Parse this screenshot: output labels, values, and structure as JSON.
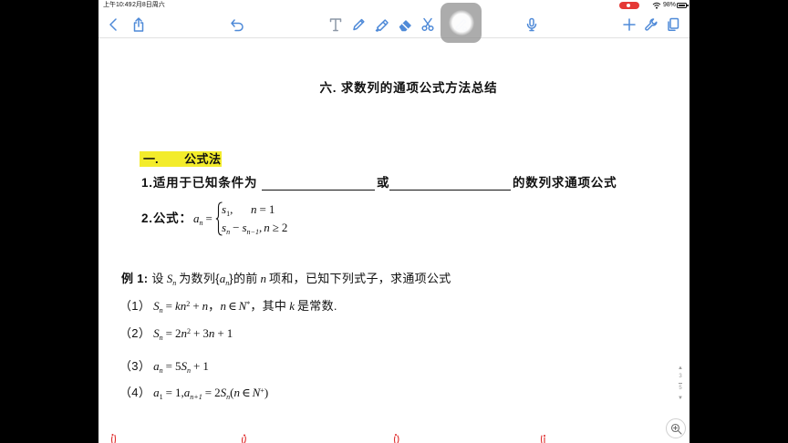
{
  "status_bar": {
    "time": "上午10:49",
    "date": "2月8日周六",
    "battery": "98%",
    "icons": [
      "screen-recording-icon",
      "wifi-icon",
      "battery-icon"
    ]
  },
  "toolbar": {
    "left_icons": [
      "chevron-left-icon",
      "share-icon",
      "undo-icon"
    ],
    "tools": [
      "text-tool-icon",
      "pen-icon",
      "highlighter-icon",
      "eraser-icon",
      "scissors-icon",
      "laser-pointer-icon",
      "microphone-icon"
    ],
    "right_icons": [
      "plus-icon",
      "wrench-icon",
      "pages-icon"
    ],
    "active_tool": "laser-pointer-icon"
  },
  "colors": {
    "accent": "#4f8ad8",
    "highlight": "#f3ec2b",
    "recording": "#e53935",
    "ink": "#e02d2d",
    "text": "#111111"
  },
  "document": {
    "title": "六. 求数列的通项公式方法总结",
    "section": {
      "number": "一.",
      "name": "公式法"
    },
    "item1": {
      "text_a": "1.适用于已知条件为",
      "text_b": "或",
      "text_c": "的数列求通项公式"
    },
    "item2": {
      "label": "2.公式：",
      "lhs": [
        "a",
        "n",
        "="
      ],
      "case1": [
        "s",
        "1",
        ",",
        "n",
        "=",
        "1"
      ],
      "case2": [
        "s",
        "n",
        "−",
        "s",
        "n−1",
        ",",
        "n",
        "≥",
        "2"
      ]
    },
    "example1": {
      "label": "例 1:",
      "intro": [
        "设",
        "S",
        "n",
        "为数列{",
        "a",
        "n",
        "}的前",
        "n",
        "项和，已知下列式子，求通项公式"
      ],
      "items": [
        [
          "（1）",
          "S",
          "n",
          "=",
          "kn",
          "2",
          "+",
          "n",
          "，",
          "n",
          "∈",
          "N",
          "*",
          "，其中",
          "k",
          "是常数."
        ],
        [
          "（2）",
          "S",
          "n",
          "=",
          "2",
          "n",
          "2",
          "+",
          "3",
          "n",
          "+",
          "1"
        ],
        [
          "（3）",
          "a",
          "n",
          "=",
          "5",
          "S",
          "n",
          "+",
          "1"
        ],
        [
          "（4）",
          "a",
          "1",
          "=",
          "1,",
          "a",
          "n+1",
          "=",
          "2",
          "S",
          "n",
          "(",
          "n",
          "∈",
          "N",
          "+",
          ")"
        ]
      ]
    }
  },
  "page_indicator": {
    "current": "3",
    "total": "5"
  },
  "zoom_button": {
    "icon": "zoom-in-icon"
  }
}
